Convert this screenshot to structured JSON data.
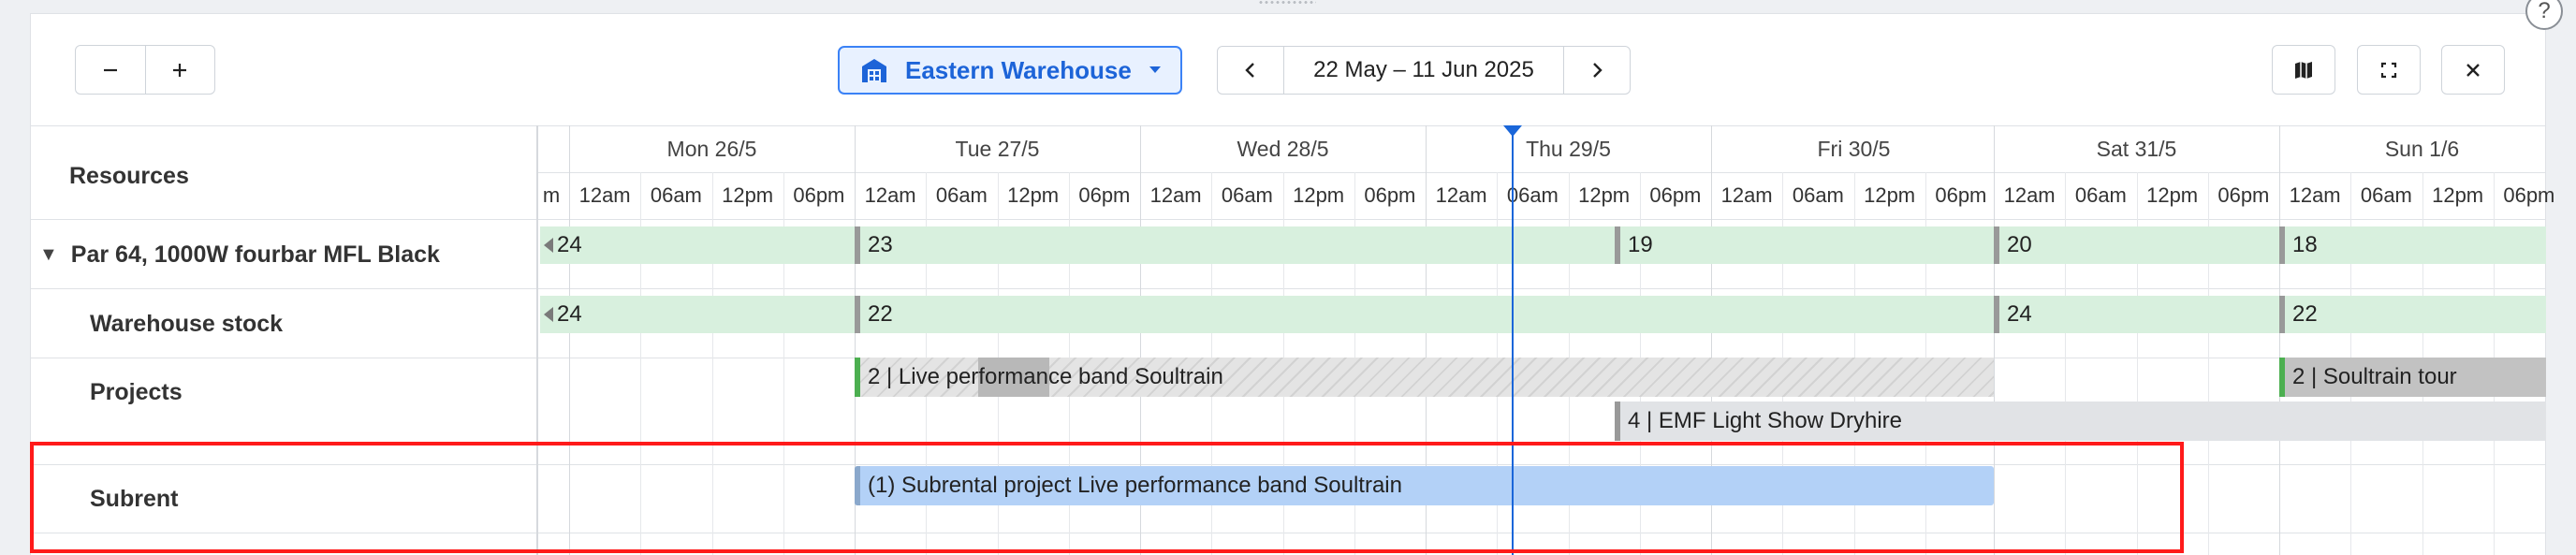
{
  "toolbar": {
    "zoom_out_icon": "minus-icon",
    "zoom_in_icon": "plus-icon",
    "warehouse": {
      "label": "Eastern Warehouse",
      "icon": "warehouse-icon",
      "accent": "#1d64d8"
    },
    "date_range": "22 May – 11 Jun 2025",
    "prev_icon": "chevron-left-icon",
    "next_icon": "chevron-right-icon",
    "map_icon": "map-icon",
    "fullscreen_icon": "fullscreen-icon",
    "close_icon": "close-icon",
    "help_icon": "help-icon"
  },
  "grid": {
    "resources_header": "Resources",
    "days": [
      "Mon 26/5",
      "Tue 27/5",
      "Wed 28/5",
      "Thu 29/5",
      "Fri 30/5",
      "Sat 31/5",
      "Sun 1/6"
    ],
    "partial_hour": "m",
    "hours": [
      "12am",
      "06am",
      "12pm",
      "06pm"
    ],
    "rows": {
      "product": "Par 64, 1000W fourbar MFL Black",
      "warehouse_stock": "Warehouse stock",
      "projects": "Projects",
      "subrent": "Subrent"
    },
    "product_values": [
      "24",
      "23",
      "19",
      "20",
      "18"
    ],
    "stock_values": [
      "24",
      "22",
      "24",
      "22"
    ],
    "projects": [
      {
        "label": "2 | Live performance band Soultrain"
      },
      {
        "label": "2 | Soultrain tour"
      },
      {
        "label": "4 | EMF Light Show Dryhire"
      }
    ],
    "subrent_label": "(1) Subrental project Live performance band Soultrain"
  }
}
